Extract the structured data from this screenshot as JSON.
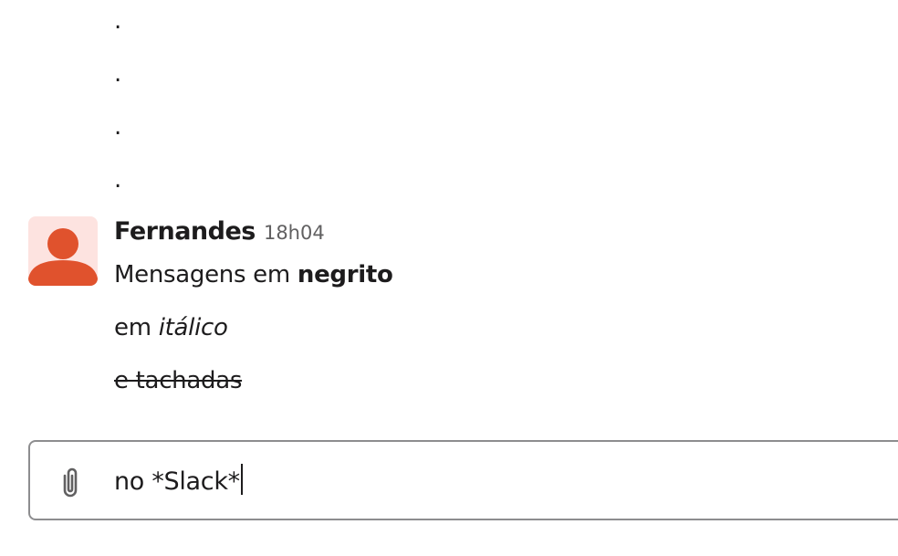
{
  "history_dots": [
    ".",
    ".",
    ".",
    "."
  ],
  "message": {
    "sender": "Fernandes",
    "time": "18h04",
    "line1_plain": "Mensagens em ",
    "line1_bold": "negrito",
    "line2_plain": "em ",
    "line2_italic": "itálico",
    "line3_strike": "e tachadas"
  },
  "composer": {
    "value": "no *Slack*",
    "attach_icon": "paperclip-icon"
  },
  "colors": {
    "avatar_bg": "#fde3e0",
    "avatar_fg": "#e0522d",
    "text": "#1d1c1d",
    "muted": "#616061",
    "border": "#8d8d8f"
  }
}
